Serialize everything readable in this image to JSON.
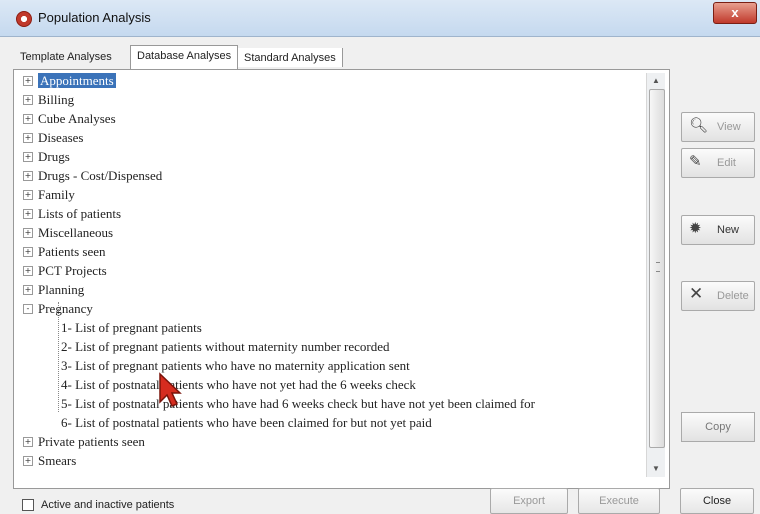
{
  "window": {
    "title": "Population Analysis",
    "close_glyph": "x"
  },
  "tabs": [
    {
      "label": "Template Analyses"
    },
    {
      "label": "Database Analyses"
    },
    {
      "label": "Standard Analyses"
    }
  ],
  "tree": {
    "items": [
      {
        "label": "Appointments",
        "expander": "+"
      },
      {
        "label": "Billing",
        "expander": "+"
      },
      {
        "label": "Cube Analyses",
        "expander": "+"
      },
      {
        "label": "Diseases",
        "expander": "+"
      },
      {
        "label": "Drugs",
        "expander": "+"
      },
      {
        "label": "Drugs - Cost/Dispensed",
        "expander": "+"
      },
      {
        "label": "Family",
        "expander": "+"
      },
      {
        "label": "Lists of patients",
        "expander": "+"
      },
      {
        "label": "Miscellaneous",
        "expander": "+"
      },
      {
        "label": "Patients seen",
        "expander": "+"
      },
      {
        "label": "PCT Projects",
        "expander": "+"
      },
      {
        "label": "Planning",
        "expander": "+"
      },
      {
        "label": "Pregnancy",
        "expander": "-"
      }
    ],
    "pregnancy_children": [
      {
        "label": "1- List of pregnant patients"
      },
      {
        "label": "2- List of pregnant patients without maternity number recorded"
      },
      {
        "label": "3- List of pregnant patients who have no maternity application sent"
      },
      {
        "label": "4- List of postnatal patients who have not yet had the 6 weeks check"
      },
      {
        "label": "5- List of postnatal patients who have had 6 weeks check but have not yet been claimed for"
      },
      {
        "label": "6- List of postnatal patients who have been claimed for but not yet paid"
      }
    ],
    "after_items": [
      {
        "label": "Private patients seen",
        "expander": "+"
      },
      {
        "label": "Smears",
        "expander": "+"
      }
    ]
  },
  "side_buttons": {
    "view": {
      "label": "View",
      "icon": "magnifier-icon"
    },
    "edit": {
      "label": "Edit",
      "icon": "edit-icon"
    },
    "new": {
      "label": "New",
      "icon": "new-icon"
    },
    "delete": {
      "label": "Delete",
      "icon": "delete-icon"
    },
    "copy": {
      "label": "Copy"
    }
  },
  "footer": {
    "checkbox_label": "Active and inactive patients",
    "export_label": "Export",
    "execute_label": "Execute",
    "close_label": "Close"
  },
  "colors": {
    "selection": "#3b73b9",
    "close_button": "#c0392b"
  }
}
